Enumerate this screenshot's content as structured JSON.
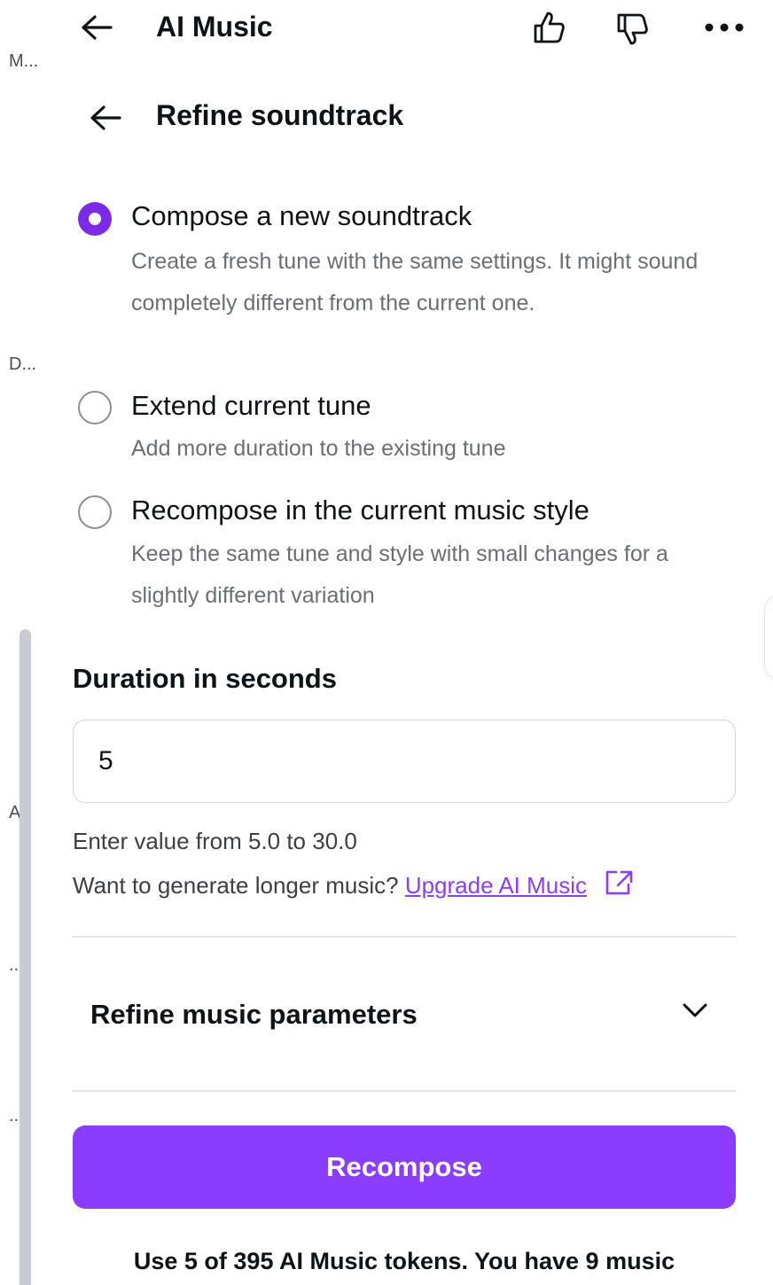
{
  "side": {
    "truncated_labels": [
      "M...",
      "D...",
      "AI",
      "...",
      "..."
    ]
  },
  "header": {
    "title": "AI Music",
    "back_icon": "arrow-left-icon",
    "like_icon": "thumbs-up-icon",
    "dislike_icon": "thumbs-down-icon",
    "more_icon": "more-horizontal-icon"
  },
  "subheader": {
    "title": "Refine soundtrack",
    "back_icon": "arrow-left-icon"
  },
  "options": [
    {
      "label": "Compose a new soundtrack",
      "description": "Create a fresh tune with the same settings. It might sound completely different from the current one.",
      "selected": true
    },
    {
      "label": "Extend current tune",
      "description": "Add more duration to the existing tune",
      "selected": false
    },
    {
      "label": "Recompose in the current music style",
      "description": "Keep the same tune and style with small changes for a slightly different variation",
      "selected": false
    }
  ],
  "duration": {
    "title": "Duration in seconds",
    "value": "5",
    "range_hint": "Enter value from 5.0 to 30.0",
    "upgrade_prompt": "Want to generate longer music?",
    "upgrade_link": "Upgrade AI Music",
    "external_icon": "external-link-icon"
  },
  "parameters": {
    "label": "Refine music parameters",
    "chevron_icon": "chevron-down-icon"
  },
  "action": {
    "button_label": "Recompose"
  },
  "footnote": "Use 5 of 395 AI Music tokens. You have 9 music",
  "colors": {
    "accent": "#8b3dff",
    "radio_selected": "#7d2ae8",
    "text_primary": "#0e1318",
    "text_secondary": "#6a6f76"
  }
}
